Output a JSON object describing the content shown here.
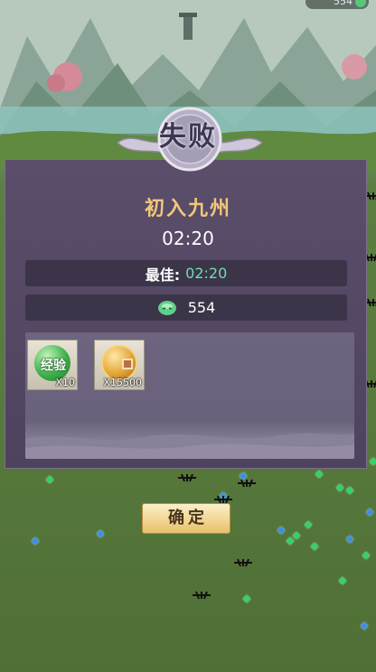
{
  "hud": {
    "top_counter": "554"
  },
  "result": {
    "status_text": "失败",
    "stage_title": "初入九州",
    "time": "02:20",
    "best_label": "最佳:",
    "best_value": "02:20",
    "coin_amount": "554"
  },
  "rewards": [
    {
      "icon": "exp-orb-icon",
      "label": "经验",
      "quantity": "X10"
    },
    {
      "icon": "copper-coin-icon",
      "label": "",
      "quantity": "X15500"
    }
  ],
  "buttons": {
    "confirm_label": "确定"
  },
  "colors": {
    "panel": "#564a66",
    "title_gold": "#f3c77a",
    "best_green": "#6ee0b0",
    "button_gold": "#f2d793"
  }
}
